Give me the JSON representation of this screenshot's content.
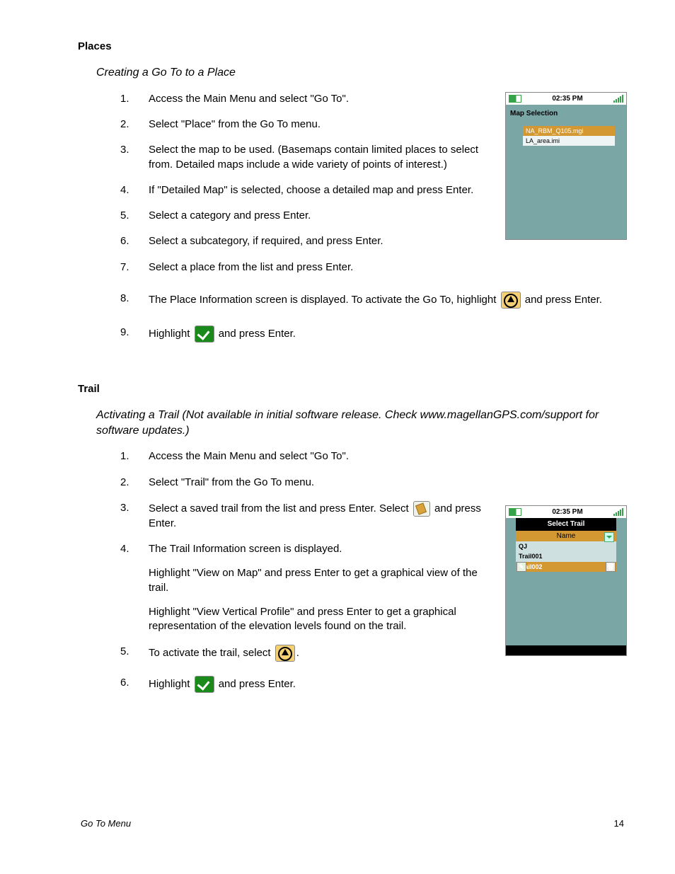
{
  "sections": {
    "places": {
      "heading": "Places",
      "subheading": "Creating a Go To to a Place",
      "steps": [
        "Access the Main Menu and select \"Go To\".",
        "Select \"Place\" from the Go To menu.",
        "Select the map to be used.  (Basemaps contain limited places to select from. Detailed maps include a wide variety of points of interest.)",
        "If \"Detailed Map\" is selected, choose a detailed map and press Enter.",
        "Select a category and press Enter.",
        "Select a subcategory, if required, and press Enter.",
        "Select a place from the list and press Enter."
      ],
      "step8_pre": "The Place Information screen is displayed. To activate the Go To, highlight ",
      "step8_post": " and press Enter.",
      "step9_pre": "Highlight ",
      "step9_post": " and press Enter."
    },
    "trail": {
      "heading": "Trail",
      "subheading": "Activating a Trail (Not available in initial software release.  Check www.magellanGPS.com/support for software updates.)",
      "steps_a": [
        "Access the Main Menu and select \"Go To\".",
        "Select \"Trail\" from the Go To menu."
      ],
      "step3_pre": "Select a saved trail from the list and press Enter. Select ",
      "step3_post": " and press Enter.",
      "step4_a": "The Trail Information screen is displayed.",
      "step4_b": "Highlight \"View on Map\" and press Enter to get a graphical view of the trail.",
      "step4_c": "Highlight \"View Vertical Profile\" and press Enter to get a graphical representation of the elevation levels found on the trail.",
      "step5_pre": "To activate the trail, select ",
      "step5_post": ".",
      "step6_pre": "Highlight ",
      "step6_post": " and press Enter."
    }
  },
  "device1": {
    "time": "02:35 PM",
    "title": "Map Selection",
    "rows": [
      "NA_RBM_Q105.mgi",
      "LA_area.imi"
    ]
  },
  "device2": {
    "time": "02:35 PM",
    "header": "Select Trail",
    "colhead": "Name",
    "rows": [
      "QJ",
      "Trail001",
      "Trail002"
    ]
  },
  "footer": {
    "left": "Go To Menu",
    "page": "14"
  }
}
